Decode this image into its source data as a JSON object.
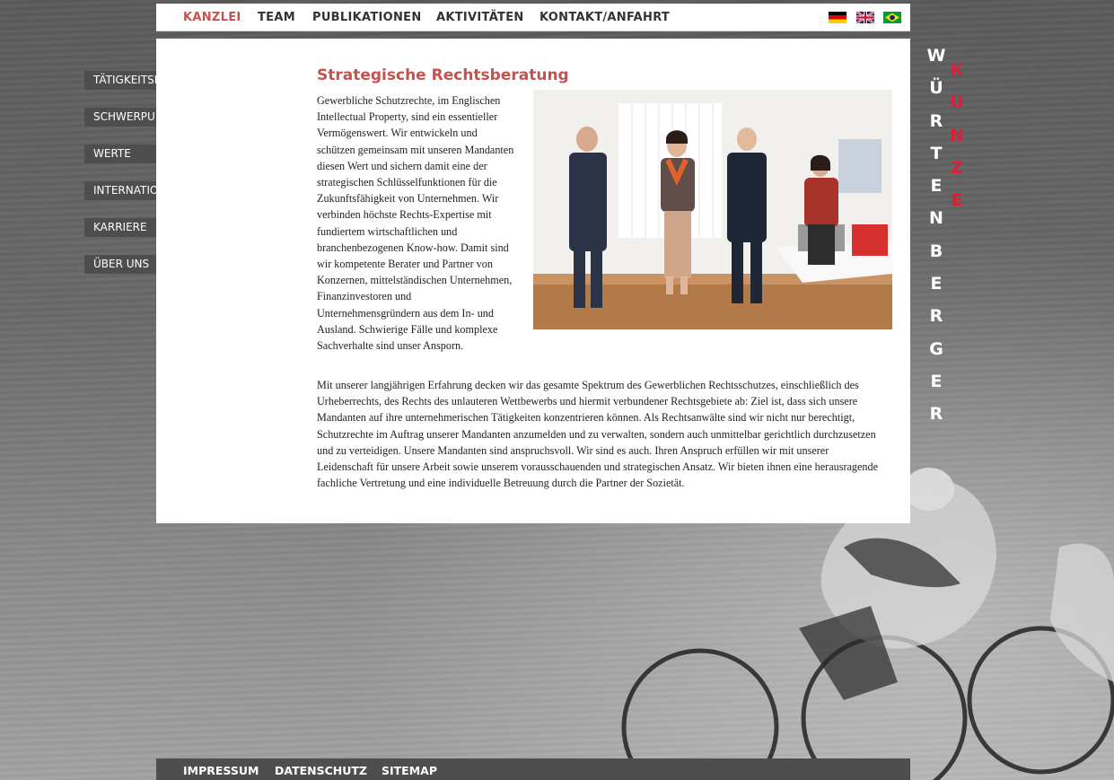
{
  "topnav": {
    "items": [
      "KANZLEI",
      "TEAM",
      "PUBLIKATIONEN",
      "AKTIVITÄTEN",
      "KONTAKT/ANFAHRT"
    ],
    "active": "KANZLEI",
    "flags": [
      "german-flag-icon",
      "uk-flag-icon",
      "brazil-flag-icon"
    ]
  },
  "sidebar": {
    "items": [
      "TÄTIGKEITSFELD",
      "SCHWERPUNKTE",
      "WERTE",
      "INTERNATIONALE PRÄSENZ",
      "KARRIERE",
      "ÜBER UNS"
    ]
  },
  "main": {
    "heading": "Strategische Rechtsberatung",
    "intro": "Gewerbliche Schutzrechte, im Englischen Intellectual Property, sind ein essentieller Vermögenswert. Wir entwickeln und schützen gemeinsam mit unseren Mandanten diesen Wert und sichern damit eine der strategischen Schlüsselfunktionen für die Zukunftsfähigkeit von Unternehmen. Wir verbinden höchste Rechts-Expertise mit fundiertem wirtschaftlichen und branchenbezogenen Know-how. Damit sind wir kompetente Berater und Partner von Konzernen, mittelständischen Unternehmen, Finanzinvestoren und Unternehmensgründern aus dem In- und Ausland. Schwierige Fälle und komplexe Sachverhalte sind unser Ansporn.",
    "body": "Mit unserer langjährigen Erfahrung decken wir das gesamte Spektrum des Gewerblichen Rechtsschutzes, einschließlich des Urheberrechts, des Rechts des unlauteren Wettbewerbs und hiermit verbundener Rechtsgebiete ab: Ziel ist, dass sich unsere Mandanten auf ihre unternehmerischen Tätigkeiten konzentrieren können. Als Rechtsanwälte sind wir nicht nur berechtigt, Schutzrechte im Auftrag unserer Mandanten anzumelden und zu verwalten, sondern auch unmittelbar gerichtlich durchzusetzen und zu verteidigen. Unsere Mandanten sind anspruchsvoll. Wir sind es auch. Ihren Anspruch erfüllen wir mit unserer Leidenschaft für unsere Arbeit sowie unserem vorausschauenden und strategischen Ansatz. Wir bieten ihnen eine herausragende fachliche Vertretung und eine individuelle Betreuung durch die Partner der Sozietät."
  },
  "brand": {
    "primary_letters": [
      "W",
      "Ü",
      "R",
      "T",
      "E",
      "N",
      "B",
      "E",
      "R",
      "G",
      "E",
      "R"
    ],
    "secondary_letters": [
      "K",
      "U",
      "N",
      "Z",
      "E"
    ],
    "primary_color": "#ffffff",
    "secondary_color": "#d9203a"
  },
  "footer": {
    "items": [
      "IMPRESSUM",
      "DATENSCHUTZ",
      "SITEMAP"
    ]
  },
  "colors": {
    "accent": "#c4524f",
    "nav_dark": "#4e4e4e"
  }
}
